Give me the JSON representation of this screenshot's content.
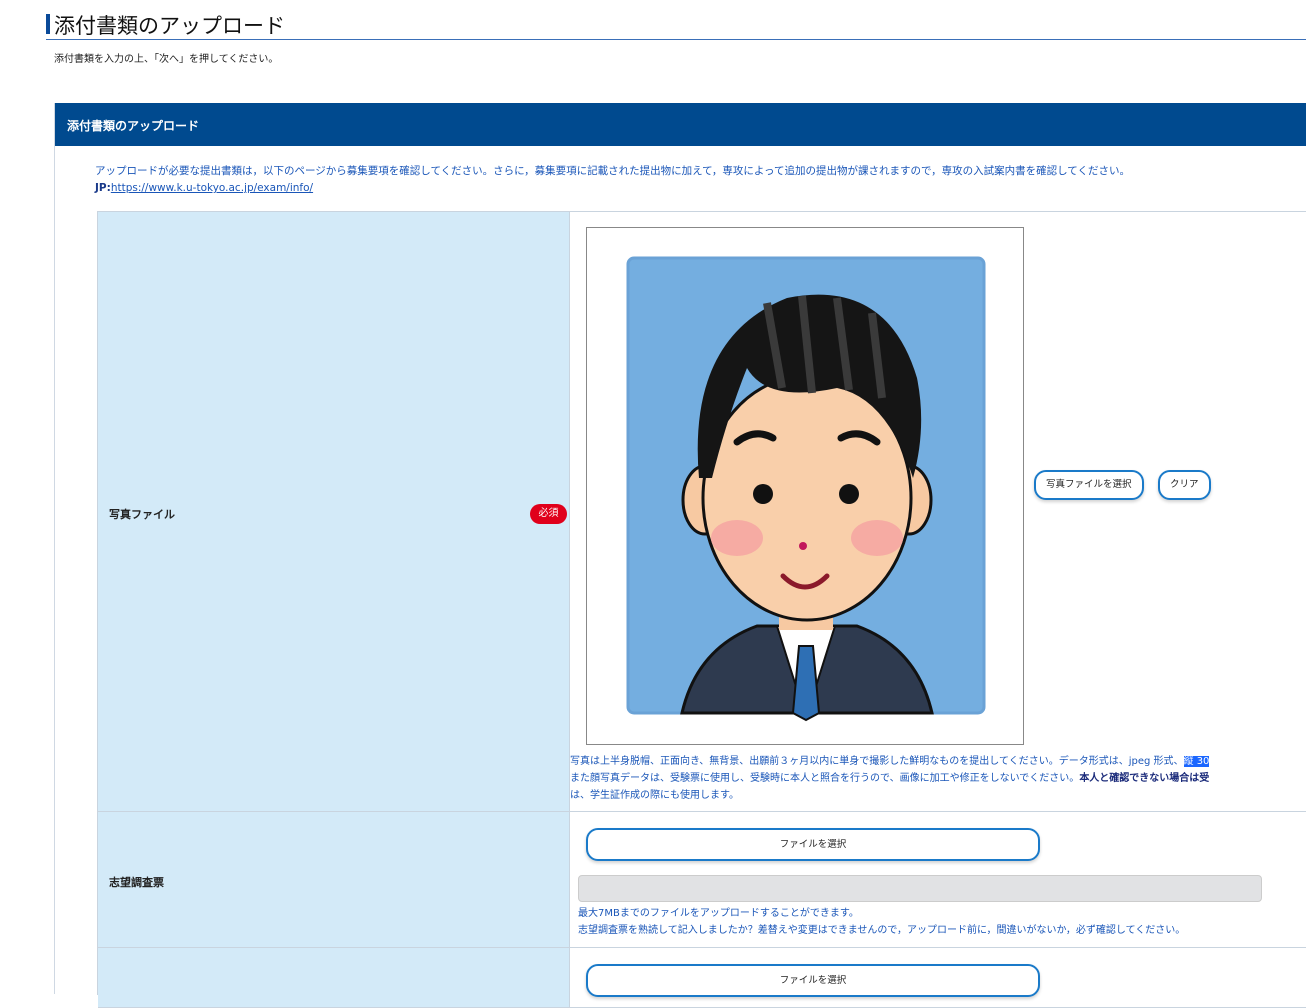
{
  "page": {
    "title": "添付書類のアップロード",
    "subtitle": "添付書類を入力の上、「次へ」を押してください。"
  },
  "panel": {
    "header": "添付書類のアップロード",
    "notice_line1": "アップロードが必要な提出書類は，以下のページから募集要項を確認してください。さらに，募集要項に記載された提出物に加えて，専攻によって追加の提出物が課されますので，専攻の入試案内書を確認してください。",
    "notice_jp_prefix": "JP:",
    "notice_link": "https://www.k.u-tokyo.ac.jp/exam/info/"
  },
  "rows": {
    "photo": {
      "label": "写真ファイル",
      "required": "必須",
      "select_button": "写真ファイルを選択",
      "clear_button": "クリア",
      "note_line1": "写真は上半身脱帽、正面向き、無背景、出願前３ヶ月以内に単身で撮影した鮮明なものを提出してください。データ形式は、jpeg 形式、",
      "note_line1_highlight": "縦 30",
      "note_line2": "また顔写真データは、受験票に使用し、受験時に本人と照合を行うので、画像に加工や修正をしないでください。",
      "note_line2_bold": "本人と確認できない場合は受",
      "note_line3": "は、学生証作成の際にも使用します。"
    },
    "survey": {
      "label": "志望調査票",
      "file_button": "ファイルを選択",
      "note_line1": "最大7MBまでのファイルをアップロードすることができます。",
      "note_line2": "志望調査票を熟読して記入しましたか？差替えや変更はできませんので，アップロード前に，間違いがないか，必ず確認してください。"
    },
    "third": {
      "file_button": "ファイルを選択"
    }
  },
  "colors": {
    "header_bg": "#004a8f",
    "label_bg": "#d3eaf8",
    "required_bg": "#e0001b",
    "link_text": "#1a56b8",
    "button_border": "#1a7ac9"
  }
}
